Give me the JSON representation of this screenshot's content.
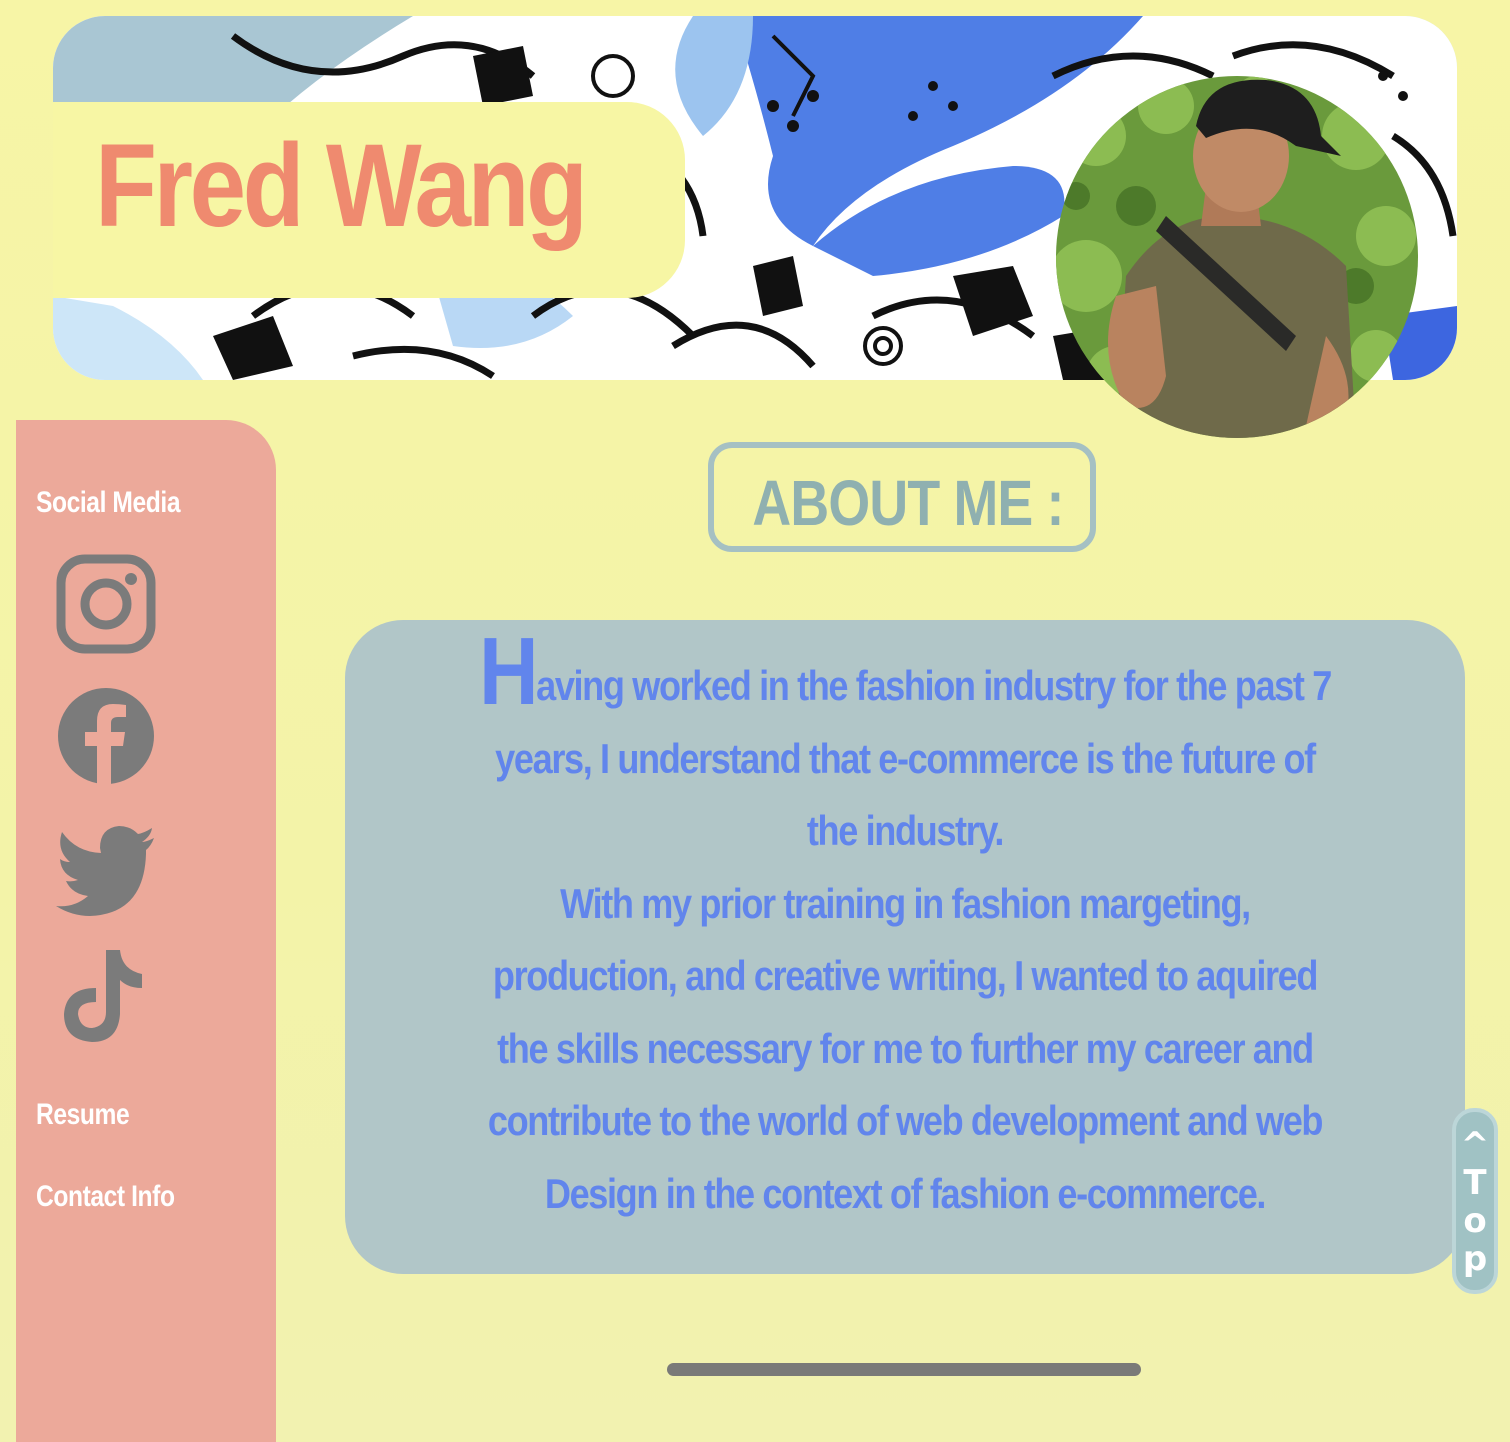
{
  "header": {
    "name": "Fred Wang"
  },
  "sidebar": {
    "social_heading": "Social Media",
    "social_icons": [
      "instagram-icon",
      "facebook-icon",
      "twitter-icon",
      "tiktok-icon"
    ],
    "links": [
      {
        "label": "Resume"
      },
      {
        "label": "Contact Info"
      }
    ]
  },
  "about": {
    "title": "ABOUT ME :",
    "drop_cap": "H",
    "lines": [
      "aving worked in the fashion industry for the past 7",
      "years, I understand that e-commerce is the future of",
      "the industry.",
      "With my prior training in fashion margeting,",
      "production, and creative writing, I wanted to aquired",
      "the skills necessary for me to further my career and",
      "contribute to the world of web development and web",
      "Design in the context of fashion e-commerce."
    ]
  },
  "top_button": {
    "chars": [
      "^",
      "T",
      "o",
      "p"
    ]
  },
  "colors": {
    "background": "#f7f5a6",
    "name": "#ef8a6f",
    "sidebar": "#eca99a",
    "bio_panel": "#b1c6c8",
    "bio_text": "#6185ec",
    "heading": "#8fb0b0"
  }
}
